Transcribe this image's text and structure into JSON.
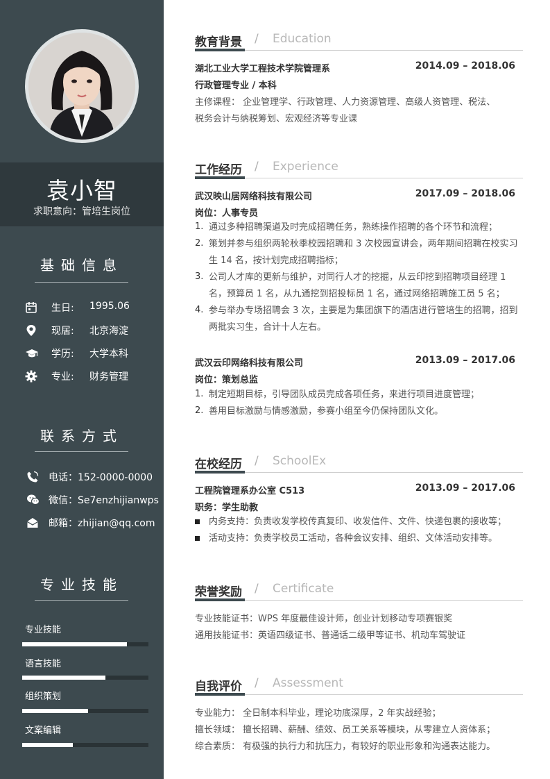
{
  "sidebar": {
    "name": "袁小智",
    "intent": "求职意向：管培生岗位",
    "basic_title": "基础信息",
    "basic": [
      {
        "label": "生日:",
        "value": "1995.06",
        "icon": "calendar-icon"
      },
      {
        "label": "现居:",
        "value": "北京海淀",
        "icon": "location-pin-icon"
      },
      {
        "label": "学历:",
        "value": "大学本科",
        "icon": "graduation-cap-icon"
      },
      {
        "label": "专业:",
        "value": "财务管理",
        "icon": "gear-icon"
      }
    ],
    "contact_title": "联系方式",
    "contact": [
      {
        "text": "电话：152-0000-0000",
        "icon": "phone-icon"
      },
      {
        "text": "微信：Se7enzhijianwps",
        "icon": "wechat-icon"
      },
      {
        "text": "邮箱：zhijian@qq.com",
        "icon": "mail-icon"
      }
    ],
    "skills_title": "专业技能",
    "skills": [
      {
        "label": "专业技能",
        "level": 0.83
      },
      {
        "label": "语言技能",
        "level": 0.66
      },
      {
        "label": "组织策划",
        "level": 0.52
      },
      {
        "label": "文案编辑",
        "level": 0.4
      }
    ]
  },
  "education": {
    "title_zh": "教育背景",
    "slash": "/",
    "title_en": "Education",
    "school": "湖北工业大学工程技术学院管理系",
    "date": "2014.09 – 2018.06",
    "major": "行政管理专业 / 本科",
    "courses_1": "主修课程：    企业管理学、行政管理、人力资源管理、高级人资管理、税法、",
    "courses_2": "税务会计与纳税筹划、宏观经济等专业课"
  },
  "experience": {
    "title_zh": "工作经历",
    "slash": "/",
    "title_en": "Experience",
    "jobs": [
      {
        "company": "武汉映山居网络科技有限公司",
        "date": "2017.09 – 2018.06",
        "role": "岗位：人事专员",
        "items": [
          "通过多种招聘渠道及时完成招聘任务，熟练操作招聘的各个环节和流程；",
          "策划并参与组织两轮秋季校园招聘和 3 次校园宣讲会，两年期间招聘在校实习生 14 名，按计划完成招聘指标；",
          "公司人才库的更新与维护，对同行人才的挖掘，从云印挖到招聘项目经理 1 名，预算员 1 名，从九通挖到招投标员 1 名，通过网络招聘施工员 5 名；",
          "参与举办专场招聘会 3 次，主要是为集团旗下的酒店进行管培生的招聘，招到两批实习生，合计十人左右。"
        ]
      },
      {
        "company": "武汉云印网络科技有限公司",
        "date": "2013.09 – 2017.06",
        "role": "岗位：策划总监",
        "items": [
          "制定短期目标，引导团队成员完成各项任务，来进行项目进度管理；",
          "善用目标激励与情感激励，参赛小组至今仍保持团队文化。"
        ]
      }
    ]
  },
  "school": {
    "title_zh": "在校经历",
    "slash": "/",
    "title_en": "SchoolEx",
    "org": "工程院管理系办公室 C513",
    "date": "2013.09 – 2017.06",
    "role": "职务：学生助教",
    "items": [
      "内务支持：负责收发学校传真复印、收发信件、文件、快递包裹的接收等；",
      "活动支持：负责学校员工活动，各种会议安排、组织、文体活动安排等。"
    ]
  },
  "certificate": {
    "title_zh": "荣誉奖励",
    "slash": "/",
    "title_en": "Certificate",
    "lines": [
      "专业技能证书：WPS 年度最佳设计师，创业计划移动专项赛银奖",
      "通用技能证书：英语四级证书、普通话二级甲等证书、机动车驾驶证"
    ]
  },
  "assessment": {
    "title_zh": "自我评价",
    "slash": "/",
    "title_en": "Assessment",
    "lines": [
      "专业能力：    全日制本科毕业，理论功底深厚，2  年实战经验；",
      "擅长领域：    擅长招聘、薪酬、绩效、员工关系等模块，从零建立人资体系；",
      "综合素质：    有极强的执行力和抗压力，有较好的职业形象和沟通表达能力。"
    ]
  },
  "colors": {
    "sidebar": "#3d4a4f",
    "name_band": "#2f393d",
    "accent": "#3d4a4f"
  }
}
